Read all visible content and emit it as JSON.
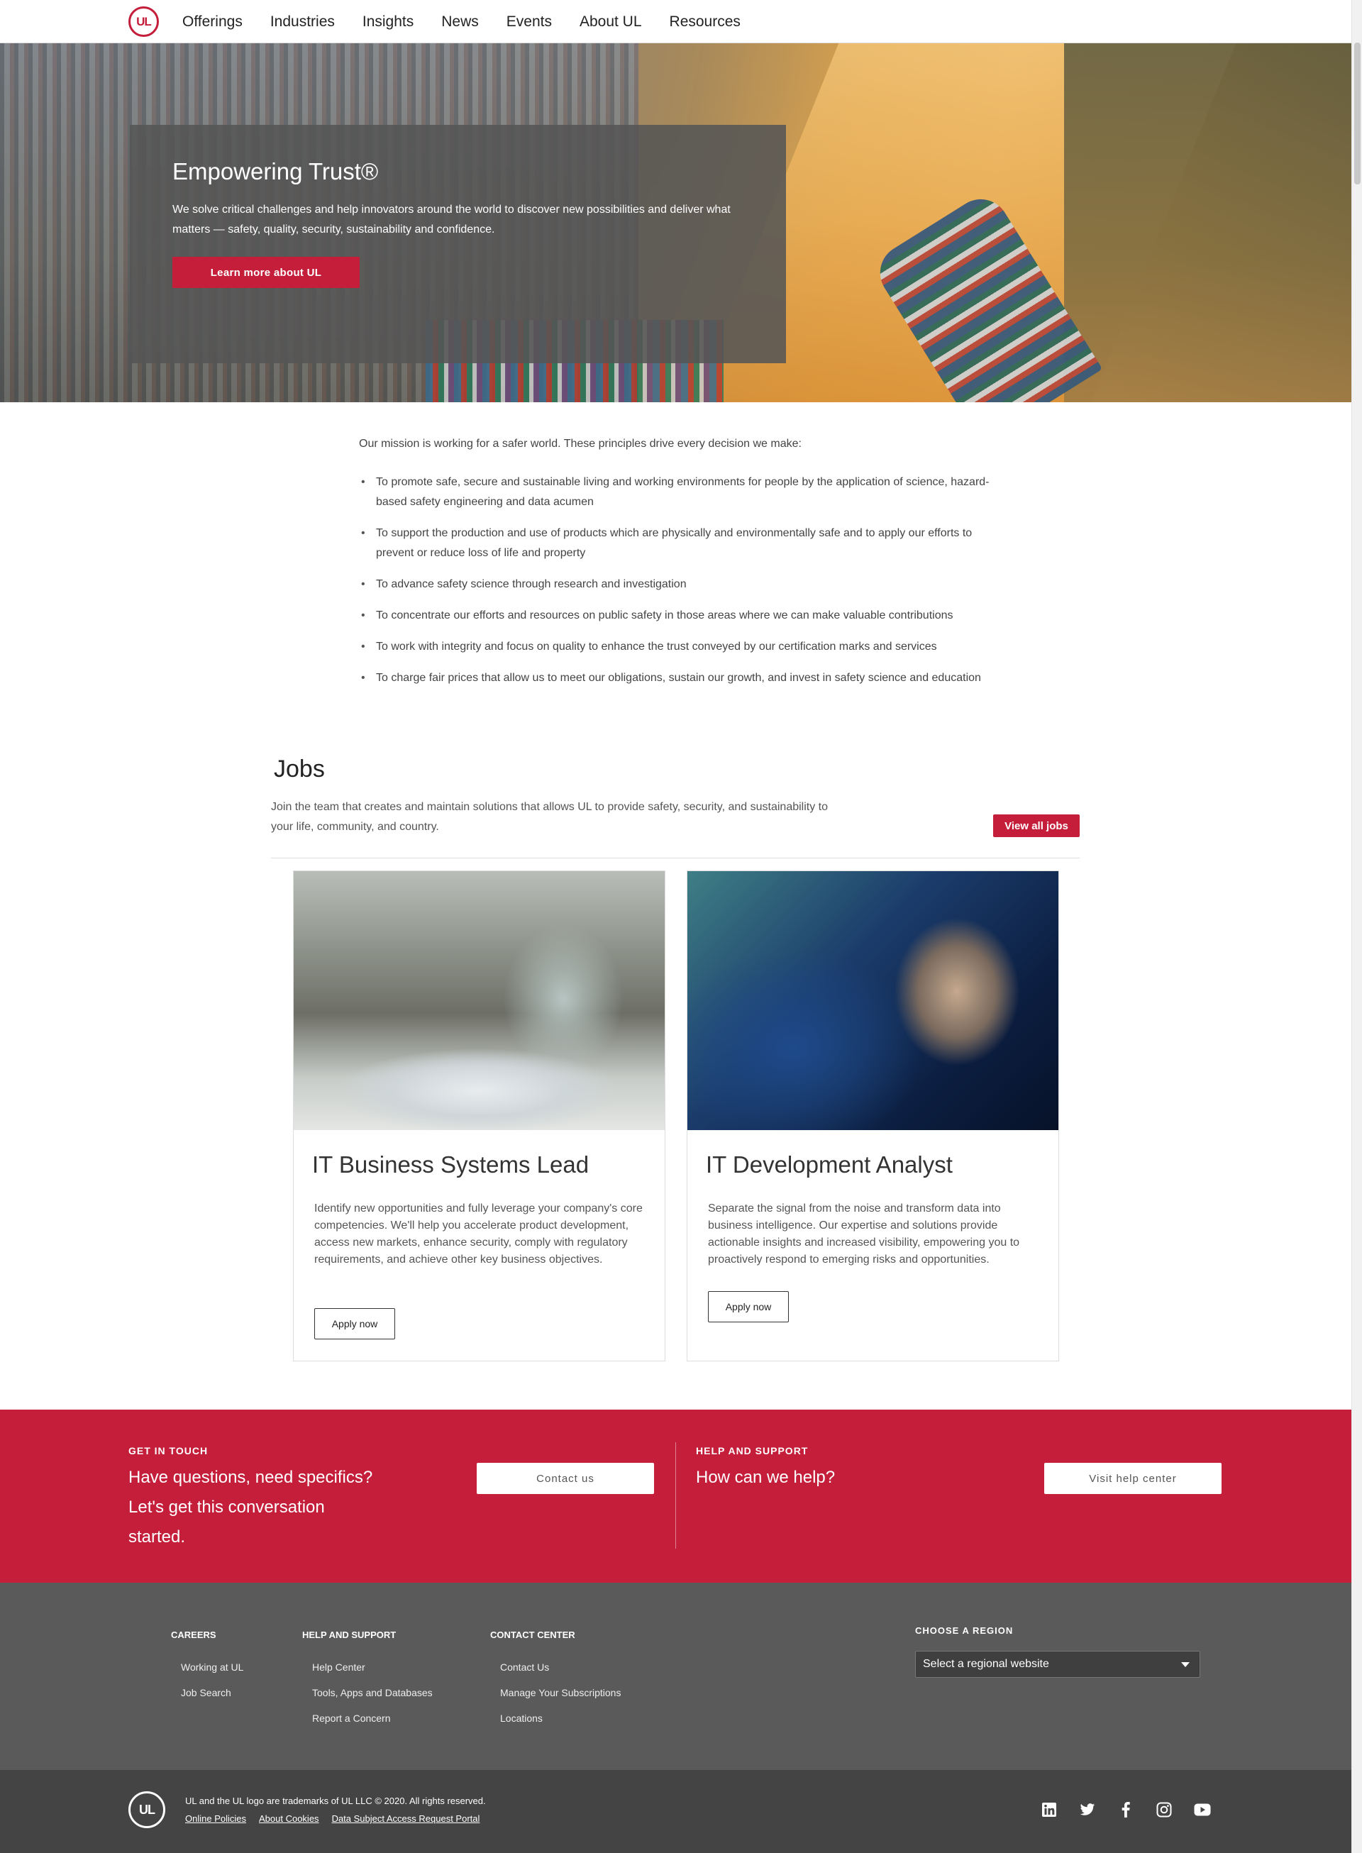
{
  "nav": {
    "logo_text": "UL",
    "items": [
      "Offerings",
      "Industries",
      "Insights",
      "News",
      "Events",
      "About UL",
      "Resources"
    ]
  },
  "hero": {
    "title": "Empowering Trust®",
    "text": "We solve critical challenges and help innovators around the world to discover new possibilities and deliver what matters — safety, quality, security, sustainability and confidence.",
    "button": "Learn more about UL"
  },
  "mission": {
    "intro": "Our mission is working for a safer world. These principles drive every decision we make:",
    "items": [
      "To promote safe, secure and sustainable living and working environments for people by the application of science, hazard-based safety engineering and data acumen",
      "To support the production and use of products which are physically and environmentally safe and to apply our efforts to prevent or reduce loss of life and property",
      "To advance safety science through research and investigation",
      "To concentrate our efforts and resources on public safety in those areas where we can make valuable contributions",
      "To work with integrity and focus on quality to enhance the trust conveyed by our certification marks and services",
      "To charge fair prices that allow us to meet our obligations, sustain our growth, and invest in safety science and education"
    ]
  },
  "jobs": {
    "title": "Jobs",
    "description": "Join the team that creates and maintain solutions that allows UL to provide safety, security, and sustainability to your life, community, and country.",
    "view_all": "View all jobs",
    "cards": [
      {
        "title": "IT Business Systems Lead",
        "text": "Identify new opportunities and fully leverage your company's core competencies. We'll help you accelerate product development, access new markets, enhance security, comply with regulatory requirements, and achieve other key business objectives.",
        "button": "Apply now"
      },
      {
        "title": "IT Development Analyst",
        "text": "Separate the signal from the noise and transform data into business intelligence. Our expertise and solutions provide actionable insights and increased visibility, empowering you to proactively respond to emerging risks and opportunities.",
        "button": "Apply now"
      }
    ]
  },
  "cta": {
    "left": {
      "label": "GET IN TOUCH",
      "heading": "Have questions, need specifics? Let's get this conversation started.",
      "button": "Contact us"
    },
    "right": {
      "label": "HELP AND SUPPORT",
      "heading": "How can we help?",
      "button": "Visit help center"
    }
  },
  "footer": {
    "columns": [
      {
        "title": "CAREERS",
        "links": [
          "Working at UL",
          "Job Search"
        ]
      },
      {
        "title": "HELP AND SUPPORT",
        "links": [
          "Help Center",
          "Tools, Apps and Databases",
          "Report a Concern"
        ]
      },
      {
        "title": "CONTACT CENTER",
        "links": [
          "Contact Us",
          "Manage Your Subscriptions",
          "Locations"
        ]
      }
    ],
    "region": {
      "label": "CHOOSE A REGION",
      "placeholder": "Select a regional website"
    }
  },
  "bottom": {
    "logo_text": "UL",
    "copyright": "UL and the UL logo are trademarks of UL LLC © 2020. All rights reserved.",
    "links": [
      "Online Policies",
      "About Cookies",
      "Data Subject Access Request Portal"
    ],
    "social": [
      "linkedin-icon",
      "twitter-icon",
      "facebook-icon",
      "instagram-icon",
      "youtube-icon"
    ]
  },
  "colors": {
    "brand_red": "#c41e3a",
    "footer_gray": "#5a5a5a",
    "footer_dark": "#444444"
  }
}
